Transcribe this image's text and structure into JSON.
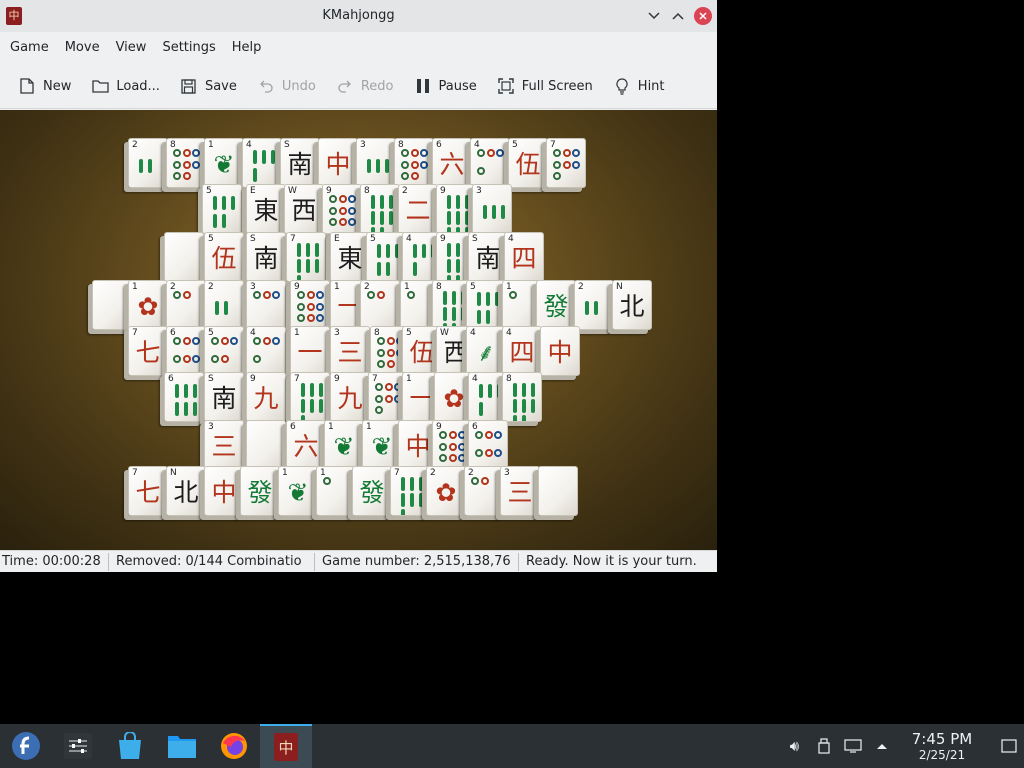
{
  "window": {
    "title": "KMahjongg",
    "icon_glyph": "中"
  },
  "menu": [
    "Game",
    "Move",
    "View",
    "Settings",
    "Help"
  ],
  "toolbar": {
    "new": "New",
    "load": "Load...",
    "save": "Save",
    "undo": "Undo",
    "redo": "Redo",
    "pause": "Pause",
    "fullscreen": "Full Screen",
    "hint": "Hint"
  },
  "status": {
    "time": "Time: 00:00:28",
    "removed": "Removed: 0/144  Combinatio",
    "game_number": "Game number: 2,515,138,76",
    "message": "Ready. Now it is your turn."
  },
  "tiles": [
    {
      "i": "2",
      "k": "sticks"
    },
    {
      "i": "8",
      "k": "dots"
    },
    {
      "i": "1",
      "k": "bird"
    },
    {
      "i": "4",
      "k": "sticks"
    },
    {
      "i": "S",
      "k": "南",
      "c": "blk"
    },
    {
      "i": "",
      "k": "中",
      "c": "red"
    },
    {
      "i": "3",
      "k": "sticks"
    },
    {
      "i": "8",
      "k": "dots"
    },
    {
      "i": "6",
      "k": "六",
      "c": "red"
    },
    {
      "i": "4",
      "k": "dots"
    },
    {
      "i": "5",
      "k": "伍",
      "c": "red"
    },
    {
      "i": "7",
      "k": "dots"
    },
    {
      "i": "5",
      "k": "sticks"
    },
    {
      "i": "E",
      "k": "東",
      "c": "blk"
    },
    {
      "i": "W",
      "k": "西",
      "c": "blk"
    },
    {
      "i": "9",
      "k": "dots"
    },
    {
      "i": "8",
      "k": "sticks"
    },
    {
      "i": "2",
      "k": "二",
      "c": "red"
    },
    {
      "i": "9",
      "k": "sticks"
    },
    {
      "i": "3",
      "k": "sticks"
    },
    {
      "i": "",
      "k": "blank"
    },
    {
      "i": "5",
      "k": "伍",
      "c": "red"
    },
    {
      "i": "S",
      "k": "南",
      "c": "blk"
    },
    {
      "i": "7",
      "k": "sticks"
    },
    {
      "i": "E",
      "k": "東",
      "c": "blk"
    },
    {
      "i": "5",
      "k": "sticks"
    },
    {
      "i": "4",
      "k": "sticks"
    },
    {
      "i": "9",
      "k": "sticks"
    },
    {
      "i": "S",
      "k": "南",
      "c": "blk"
    },
    {
      "i": "4",
      "k": "四",
      "c": "red"
    },
    {
      "i": "",
      "k": "blank"
    },
    {
      "i": "1",
      "k": "flower"
    },
    {
      "i": "2",
      "k": "dots"
    },
    {
      "i": "2",
      "k": "sticks"
    },
    {
      "i": "3",
      "k": "dots"
    },
    {
      "i": "9",
      "k": "dots"
    },
    {
      "i": "1",
      "k": "一",
      "c": "red"
    },
    {
      "i": "2",
      "k": "dots"
    },
    {
      "i": "1",
      "k": "dots"
    },
    {
      "i": "8",
      "k": "sticks"
    },
    {
      "i": "5",
      "k": "sticks"
    },
    {
      "i": "1",
      "k": "dots"
    },
    {
      "i": "",
      "k": "發",
      "c": "grn"
    },
    {
      "i": "2",
      "k": "sticks"
    },
    {
      "i": "N",
      "k": "北",
      "c": "blk"
    },
    {
      "i": "7",
      "k": "七",
      "c": "red"
    },
    {
      "i": "6",
      "k": "dots"
    },
    {
      "i": "5",
      "k": "dots"
    },
    {
      "i": "4",
      "k": "dots"
    },
    {
      "i": "1",
      "k": "一",
      "c": "red"
    },
    {
      "i": "3",
      "k": "三",
      "c": "red"
    },
    {
      "i": "8",
      "k": "dots"
    },
    {
      "i": "5",
      "k": "伍",
      "c": "red"
    },
    {
      "i": "W",
      "k": "西",
      "c": "blk"
    },
    {
      "i": "4",
      "k": "bamboo"
    },
    {
      "i": "4",
      "k": "四",
      "c": "red"
    },
    {
      "i": "",
      "k": "中",
      "c": "red"
    },
    {
      "i": "6",
      "k": "sticks"
    },
    {
      "i": "S",
      "k": "南",
      "c": "blk"
    },
    {
      "i": "9",
      "k": "九",
      "c": "red"
    },
    {
      "i": "7",
      "k": "sticks"
    },
    {
      "i": "9",
      "k": "九",
      "c": "red"
    },
    {
      "i": "7",
      "k": "dots"
    },
    {
      "i": "1",
      "k": "一",
      "c": "red"
    },
    {
      "i": "",
      "k": "flower"
    },
    {
      "i": "4",
      "k": "sticks"
    },
    {
      "i": "8",
      "k": "sticks"
    },
    {
      "i": "3",
      "k": "三",
      "c": "red"
    },
    {
      "i": "",
      "k": "blank"
    },
    {
      "i": "6",
      "k": "六",
      "c": "red"
    },
    {
      "i": "1",
      "k": "bird"
    },
    {
      "i": "1",
      "k": "bird"
    },
    {
      "i": "",
      "k": "中",
      "c": "red"
    },
    {
      "i": "9",
      "k": "dots"
    },
    {
      "i": "6",
      "k": "dots"
    },
    {
      "i": "7",
      "k": "七",
      "c": "red"
    },
    {
      "i": "N",
      "k": "北",
      "c": "blk"
    },
    {
      "i": "",
      "k": "中",
      "c": "red"
    },
    {
      "i": "",
      "k": "發",
      "c": "grn"
    },
    {
      "i": "1",
      "k": "bird"
    },
    {
      "i": "1",
      "k": "dots"
    },
    {
      "i": "",
      "k": "發",
      "c": "grn"
    },
    {
      "i": "7",
      "k": "sticks"
    },
    {
      "i": "2",
      "k": "flower"
    },
    {
      "i": "2",
      "k": "dots"
    },
    {
      "i": "3",
      "k": "三",
      "c": "red"
    },
    {
      "i": "",
      "k": "blank"
    }
  ]
}
